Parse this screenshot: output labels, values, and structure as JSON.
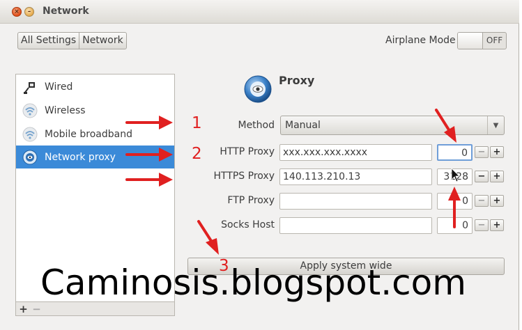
{
  "window": {
    "title": "Network"
  },
  "breadcrumbs": [
    "All Settings",
    "Network"
  ],
  "airplane": {
    "label": "Airplane Mode",
    "state": "OFF"
  },
  "sidebar": {
    "items": [
      {
        "label": "Wired",
        "icon": "wired-network-icon"
      },
      {
        "label": "Wireless",
        "icon": "wireless-icon"
      },
      {
        "label": "Mobile broadband",
        "icon": "mobile-broadband-icon"
      },
      {
        "label": "Network proxy",
        "icon": "network-proxy-icon",
        "selected": true
      }
    ],
    "footer": {
      "add": "+",
      "remove": "−"
    }
  },
  "proxy": {
    "title": "Proxy",
    "method_label": "Method",
    "method_value": "Manual",
    "rows": [
      {
        "label": "HTTP Proxy",
        "host": "xxx.xxx.xxx.xxxx",
        "port": "0"
      },
      {
        "label": "HTTPS Proxy",
        "host": "140.113.210.13",
        "port": "3128"
      },
      {
        "label": "FTP Proxy",
        "host": "",
        "port": "0"
      },
      {
        "label": "Socks Host",
        "host": "",
        "port": "0"
      }
    ],
    "apply_label": "Apply system wide"
  },
  "annotations": {
    "numbers": [
      "1",
      "2",
      "3"
    ],
    "watermark": "Caminosis.blogspot.com",
    "color": "#e02020"
  },
  "colors": {
    "selection": "#3b8ad8",
    "annotation": "#e02020"
  }
}
